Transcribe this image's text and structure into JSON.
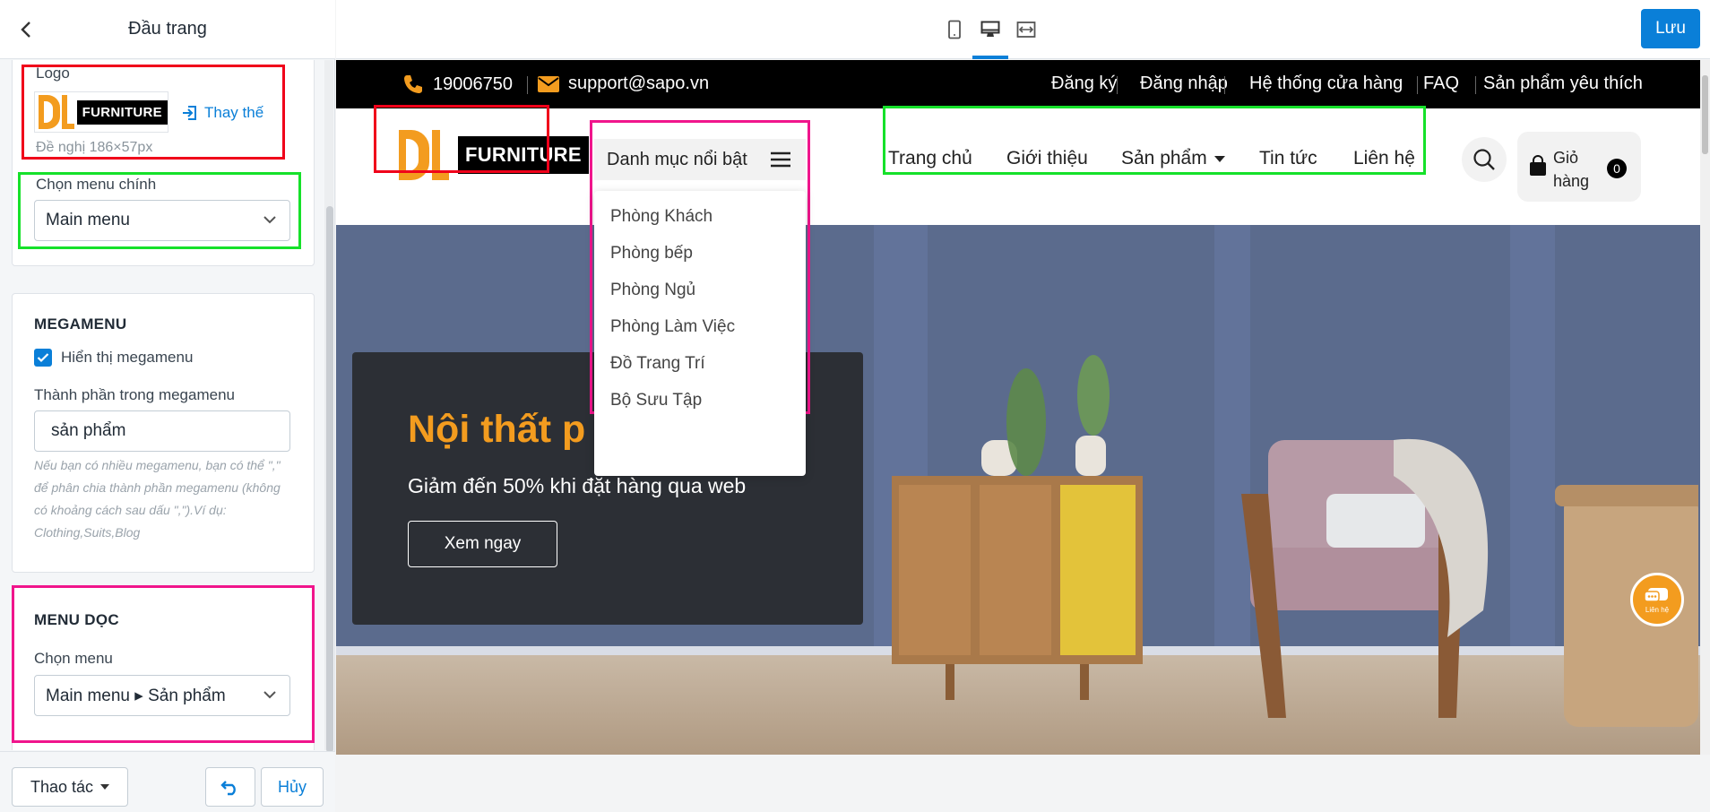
{
  "panel": {
    "title": "Đầu trang",
    "logo": {
      "label": "Logo",
      "brand_letters": "DL",
      "brand_name": "FURNITURE",
      "replace_label": "Thay thế",
      "size_hint": "Đề nghị 186×57px"
    },
    "main_menu": {
      "label": "Chọn menu chính",
      "value": "Main menu"
    },
    "megamenu": {
      "title": "MEGAMENU",
      "show_label": "Hiển thị megamenu",
      "show_checked": true,
      "items_label": "Thành phần trong megamenu",
      "items_value": "sản phẩm",
      "hint": "Nếu bạn có nhiều megamenu, bạn có thể \",\" để phân chia thành phần megamenu (không có khoảng cách sau dấu \",\").Ví dụ: Clothing,Suits,Blog"
    },
    "vertical_menu": {
      "title": "MENU DỌC",
      "label": "Chọn menu",
      "value": "Main menu ▸ Sản phẩm"
    },
    "footer": {
      "actions_label": "Thao tác",
      "cancel_label": "Hủy"
    }
  },
  "toolbar": {
    "save_label": "Lưu",
    "active_device": "desktop"
  },
  "preview": {
    "topbar": {
      "phone": "19006750",
      "email": "support@sapo.vn",
      "links": [
        "Đăng ký",
        "Đăng nhập",
        "Hệ thống cửa hàng",
        "FAQ",
        "Sản phẩm yêu thích"
      ]
    },
    "header": {
      "brand_name": "FURNITURE",
      "category_button": "Danh mục nổi bật",
      "nav": [
        "Trang chủ",
        "Giới thiệu",
        "Sản phẩm",
        "Tin tức",
        "Liên hệ"
      ],
      "cart_label": "Giỏ hàng",
      "cart_count": "0"
    },
    "category_menu": [
      "Phòng Khách",
      "Phòng bếp",
      "Phòng Ngủ",
      "Phòng Làm Việc",
      "Đồ Trang Trí",
      "Bộ Sưu Tập"
    ],
    "hero": {
      "title": "Nội thất p",
      "subtitle": "Giảm đến 50% khi đặt hàng qua web",
      "button": "Xem ngay"
    },
    "chat_label": "Liên hệ"
  },
  "colors": {
    "accent": "#0a7fd8",
    "brand_orange": "#f39c1f",
    "highlight_red": "#f0001a",
    "highlight_green": "#16e12a",
    "highlight_pink": "#f0158c"
  }
}
